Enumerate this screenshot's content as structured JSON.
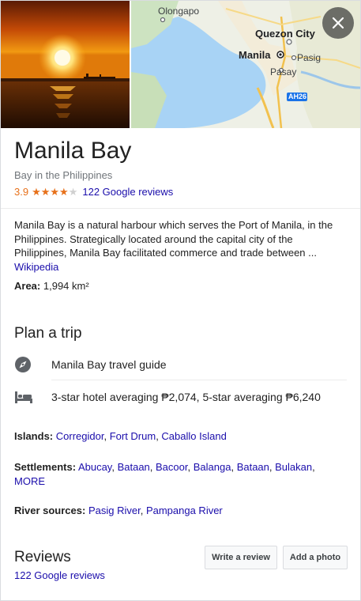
{
  "place": {
    "title": "Manila Bay",
    "subtitle": "Bay in the Philippines",
    "rating": "3.9",
    "rating_value": 3.9,
    "reviews_link": "122 Google reviews"
  },
  "map": {
    "labels": {
      "olongapo": "Olongapo",
      "quezon": "Quezon City",
      "manila": "Manila",
      "pasig": "Pasig",
      "pasay": "Pasay",
      "highway": "AH26"
    }
  },
  "description": {
    "text": "Manila Bay is a natural harbour which serves the Port of Manila, in the Philippines. Strategically located around the capital city of the Philippines, Manila Bay facilitated commerce and trade between ...",
    "source": "Wikipedia"
  },
  "area": {
    "label": "Area:",
    "value": "1,994 km²"
  },
  "plan_trip": {
    "heading": "Plan a trip",
    "items": [
      {
        "icon": "compass-icon",
        "text": "Manila Bay travel guide"
      },
      {
        "icon": "hotel-bed-icon",
        "text": "3-star hotel averaging ₱2,074, 5-star averaging ₱6,240"
      }
    ]
  },
  "facts": {
    "islands": {
      "label": "Islands:",
      "values": [
        "Corregidor",
        "Fort Drum",
        "Caballo Island"
      ]
    },
    "settlements": {
      "label": "Settlements:",
      "values": [
        "Abucay",
        "Bataan",
        "Bacoor",
        "Balanga",
        "Bataan",
        "Bulakan"
      ],
      "more": "MORE"
    },
    "river_sources": {
      "label": "River sources:",
      "values": [
        "Pasig River",
        "Pampanga River"
      ]
    }
  },
  "reviews": {
    "heading": "Reviews",
    "link": "122 Google reviews",
    "write_button": "Write a review",
    "photo_button": "Add a photo"
  },
  "colors": {
    "link": "#1a0dab",
    "star": "#e7711b",
    "muted": "#70757a"
  }
}
